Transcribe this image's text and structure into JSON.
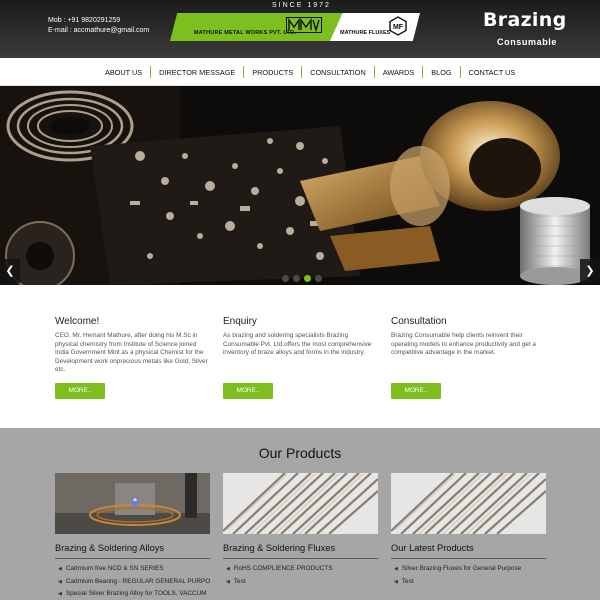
{
  "header": {
    "contact_mobile": "Mob : +91 9820291259",
    "contact_email": "E-mail : accmathure@gmail.com",
    "since": "SINCE 1972",
    "company_name": "MATHURE METAL WORKS PVT. LTD.",
    "logo_mmw_text": "MMW",
    "fluxes_name": "MATHURE FLUXES",
    "logo_mf_text": "MF",
    "brand_title": "Brazing",
    "brand_subtitle": "Consumable",
    "accent_color": "#7cbf1f"
  },
  "nav": {
    "items": [
      {
        "label": "ABOUT US"
      },
      {
        "label": "DIRECTOR MESSAGE"
      },
      {
        "label": "PRODUCTS"
      },
      {
        "label": "CONSULTATION"
      },
      {
        "label": "AWARDS"
      },
      {
        "label": "BLOG"
      },
      {
        "label": "CONTACT US"
      }
    ]
  },
  "slider": {
    "prev_icon": "chevron-left-icon",
    "next_icon": "chevron-right-icon",
    "prev_glyph": "❮",
    "next_glyph": "❯",
    "slide_count": 4,
    "active_slide": 3
  },
  "intro": [
    {
      "title": "Welcome!",
      "text": "CEO. Mr. Hemant Mathure, after doing his M.Sc in physical chemistry from Institute of Science joined India Government Mint as a physical Chemist for the Development work onprecious metals like Gold, Silver etc.",
      "button": "MORE.."
    },
    {
      "title": "Enquiry",
      "text": "As brazing and soldering specialists Brazing Consumable Pvt. Ltd.offers the most comprehensive inventory of braze alloys and forms in the industry.",
      "button": "MORE.."
    },
    {
      "title": "Consultation",
      "text": "Brazing Consumable help clients reinvent their operating models to enhance productivity and get a competitive advantage in the market.",
      "button": "MORE.."
    }
  ],
  "products": {
    "title": "Our Products",
    "cards": [
      {
        "title": "Brazing & Soldering Alloys",
        "items": [
          "Cadmium free NCD & SN SERIES",
          "Cadmium Bearing - REGULAR GENERAL PURPOSE",
          "Special Silver Brazing Alloy for TOOLS, VACCUM"
        ]
      },
      {
        "title": "Brazing & Soldering Fluxes",
        "items": [
          "RoHS COMPLIENCE PRODUCTS",
          "Test"
        ]
      },
      {
        "title": "Our Latest Products",
        "items": [
          "Silver Brazing Fluxes for General Purpose",
          "Test"
        ]
      }
    ]
  }
}
